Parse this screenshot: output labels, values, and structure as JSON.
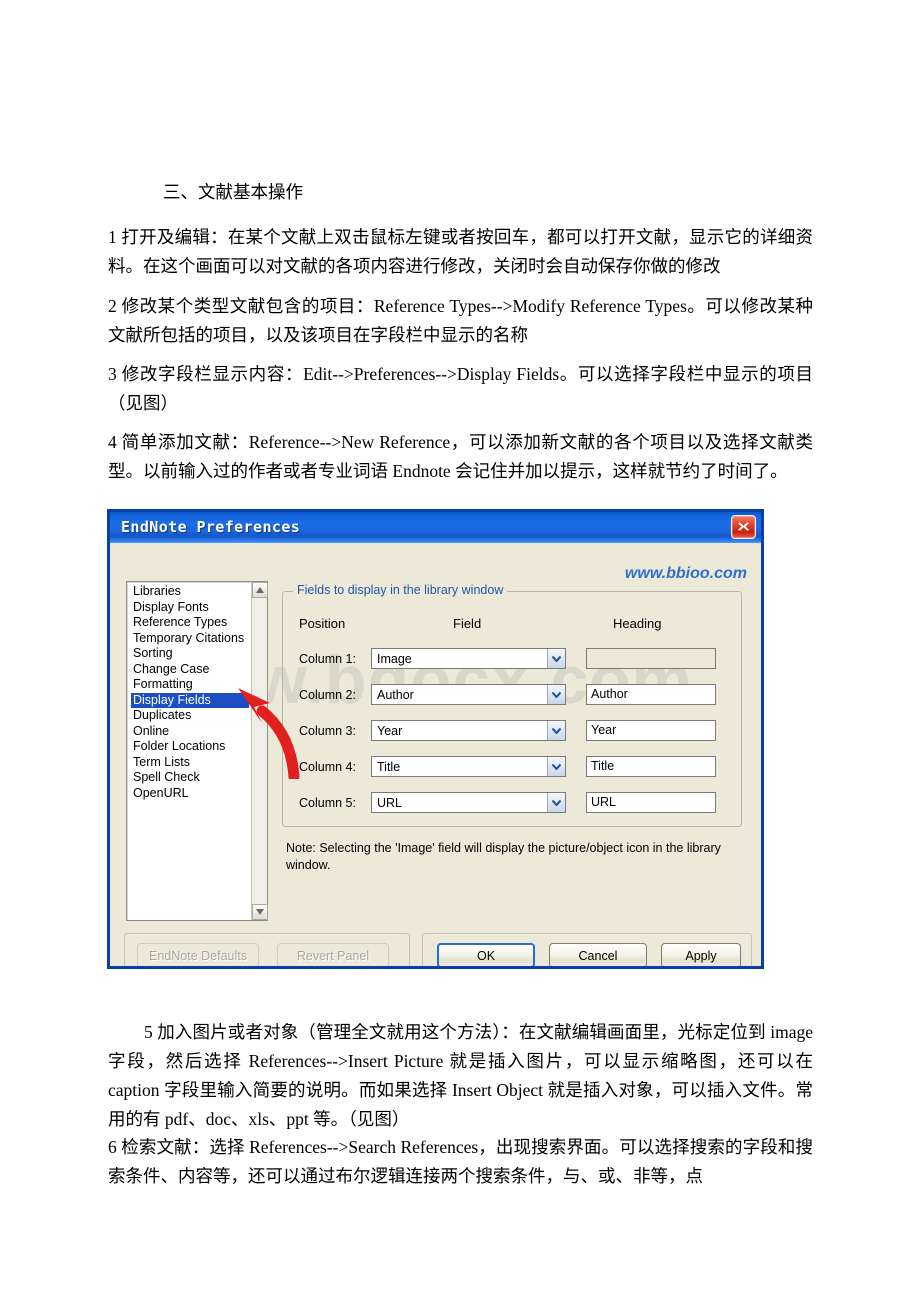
{
  "document": {
    "heading": "三、文献基本操作",
    "paragraphs": [
      "1 打开及编辑：在某个文献上双击鼠标左键或者按回车，都可以打开文献，显示它的详细资料。在这个画面可以对文献的各项内容进行修改，关闭时会自动保存你做的修改",
      "2 修改某个类型文献包含的项目：Reference Types-->Modify Reference Types。可以修改某种文献所包括的项目，以及该项目在字段栏中显示的名称",
      "3 修改字段栏显示内容：Edit-->Preferences-->Display Fields。可以选择字段栏中显示的项目（见图）",
      "4 简单添加文献：Reference-->New Reference，可以添加新文献的各个项目以及选择文献类型。以前输入过的作者或者专业词语 Endnote 会记住并加以提示，这样就节约了时间了。",
      "5 加入图片或者对象（管理全文就用这个方法）：在文献编辑画面里，光标定位到 image 字段，然后选择 References-->Insert Picture 就是插入图片，可以显示缩略图，还可以在 caption 字段里输入简要的说明。而如果选择 Insert Object 就是插入对象，可以插入文件。常用的有 pdf、doc、xls、ppt 等。（见图）",
      "6 检索文献：选择 References-->Search References，出现搜索界面。可以选择搜索的字段和搜索条件、内容等，还可以通过布尔逻辑连接两个搜索条件，与、或、非等，点"
    ]
  },
  "dialog": {
    "title": "EndNote Preferences",
    "close_icon": "close-icon",
    "watermark_large": "www.bdocx.com",
    "watermark_small": "www.bbioo.com",
    "panel_list": [
      "Libraries",
      "Display Fonts",
      "Reference Types",
      "Temporary Citations",
      "Sorting",
      "Change Case",
      "Formatting",
      "Display Fields",
      "Duplicates",
      "Online",
      "Folder Locations",
      "Term Lists",
      "Spell Check",
      "OpenURL"
    ],
    "selected_panel": "Display Fields",
    "groupbox_legend": "Fields to display in the library window",
    "column_headers": {
      "position": "Position",
      "field": "Field",
      "heading": "Heading"
    },
    "rows": [
      {
        "position": "Column 1:",
        "mnemonic": "1",
        "field": "Image",
        "heading": "",
        "heading_disabled": true
      },
      {
        "position": "Column 2:",
        "mnemonic": "2",
        "field": "Author",
        "heading": "Author",
        "heading_disabled": false
      },
      {
        "position": "Column 3:",
        "mnemonic": "3",
        "field": "Year",
        "heading": "Year",
        "heading_disabled": false
      },
      {
        "position": "Column 4:",
        "mnemonic": "4",
        "field": "Title",
        "heading": "Title",
        "heading_disabled": false
      },
      {
        "position": "Column 5:",
        "mnemonic": "5",
        "field": "URL",
        "heading": "URL",
        "heading_disabled": false
      }
    ],
    "note": "Note: Selecting the 'Image' field will display the picture/object icon in the library window.",
    "buttons": {
      "endnote_defaults": "EndNote Defaults",
      "revert_panel": "Revert Panel",
      "ok": "OK",
      "cancel": "Cancel",
      "apply": "Apply"
    },
    "colors": {
      "titlebar_blue": "#1a6ce8",
      "dialog_border": "#0a3fa8",
      "dialog_face": "#ece9d8",
      "selection_blue": "#1d4fc4",
      "legend_blue": "#2255aa",
      "close_red": "#c8230f",
      "annotation_red": "#e32020",
      "watermark_blue": "#2f6fd0"
    },
    "annotation": "red-arrow-pointing-to-display-fields"
  }
}
